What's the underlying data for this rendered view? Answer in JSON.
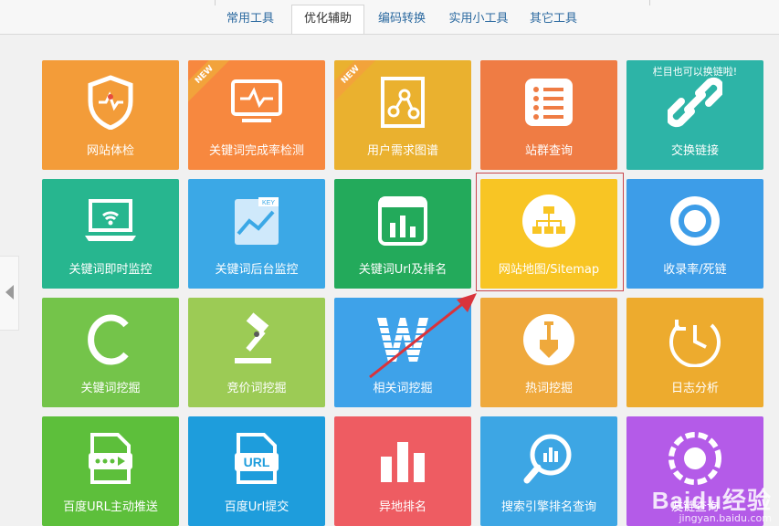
{
  "tabs": [
    {
      "label": "常用工具",
      "active": false
    },
    {
      "label": "优化辅助",
      "active": true
    },
    {
      "label": "编码转换",
      "active": false
    },
    {
      "label": "实用小工具",
      "active": false
    },
    {
      "label": "其它工具",
      "active": false
    }
  ],
  "tiles": [
    {
      "label": "网站体检",
      "color": "#f39c39",
      "icon": "shield-heartbeat-icon"
    },
    {
      "label": "关键词完成率检测",
      "color": "#f7883f",
      "icon": "monitor-pulse-icon",
      "badge": "NEW"
    },
    {
      "label": "用户需求图谱",
      "color": "#eab12f",
      "icon": "graph-nodes-icon",
      "badge": "NEW"
    },
    {
      "label": "站群查询",
      "color": "#ef7c44",
      "icon": "list-icon"
    },
    {
      "label": "交换链接",
      "color": "#2db4a7",
      "icon": "chain-link-icon",
      "tip": "栏目也可以换链啦!"
    },
    {
      "label": "关键词即时监控",
      "color": "#27b68f",
      "icon": "laptop-wifi-icon"
    },
    {
      "label": "关键词后台监控",
      "color": "#3ba8e6",
      "icon": "key-chart-icon"
    },
    {
      "label": "关键词Url及排名",
      "color": "#23aa5b",
      "icon": "bar-chart-icon"
    },
    {
      "label": "网站地图/Sitemap",
      "color": "#f8c524",
      "icon": "sitemap-icon"
    },
    {
      "label": "收录率/死链",
      "color": "#3d9de8",
      "icon": "ring-icon"
    },
    {
      "label": "关键词挖掘",
      "color": "#74c44a",
      "icon": "letter-c-icon"
    },
    {
      "label": "竞价词挖掘",
      "color": "#9ccb55",
      "icon": "gavel-icon"
    },
    {
      "label": "相关词挖掘",
      "color": "#3ea2e9",
      "icon": "letter-w-icon"
    },
    {
      "label": "热词挖掘",
      "color": "#efa93c",
      "icon": "shovel-icon"
    },
    {
      "label": "日志分析",
      "color": "#edab2e",
      "icon": "clock-icon"
    },
    {
      "label": "百度URL主动推送",
      "color": "#5dbf3b",
      "icon": "push-file-icon"
    },
    {
      "label": "百度Url提交",
      "color": "#1e9ddc",
      "icon": "url-file-icon"
    },
    {
      "label": "异地排名",
      "color": "#ee5c62",
      "icon": "bars-icon"
    },
    {
      "label": "搜索引擎排名查询",
      "color": "#3da6e4",
      "icon": "search-chart-icon"
    },
    {
      "label": "友链查询",
      "color": "#b45be8",
      "icon": "pie-icon"
    }
  ],
  "watermark": {
    "brand": "Baidu经验",
    "url": "jingyan.baidu.com"
  }
}
